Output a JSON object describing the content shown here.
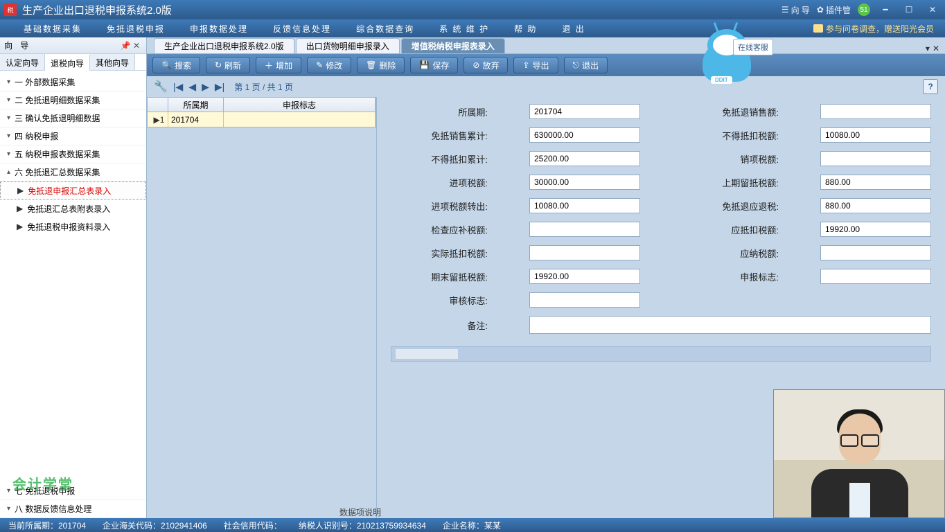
{
  "titlebar": {
    "app_title": "生产企业出口退税申报系统2.0版",
    "guide_link": "向 导",
    "plugin_link": "插件管",
    "badge": "51"
  },
  "menubar": {
    "items": [
      "基础数据采集",
      "免抵退税申报",
      "申报数据处理",
      "反馈信息处理",
      "综合数据查询",
      "系 统 维 护",
      "帮  助",
      "退  出"
    ],
    "survey": "参与问卷调查，赠送阳光会员"
  },
  "sidebar": {
    "title": "向  导",
    "tabs": [
      "认定向导",
      "退税向导",
      "其他向导"
    ],
    "active_tab": 1,
    "steps": [
      {
        "label": "一  外部数据采集"
      },
      {
        "label": "二  免抵退明细数据采集"
      },
      {
        "label": "三  确认免抵退明细数据"
      },
      {
        "label": "四  纳税申报"
      },
      {
        "label": "五  纳税申报表数据采集"
      },
      {
        "label": "六  免抵退汇总数据采集"
      }
    ],
    "children6": [
      {
        "label": "免抵退申报汇总表录入",
        "active": true
      },
      {
        "label": "免抵退汇总表附表录入"
      },
      {
        "label": "免抵退税申报资料录入"
      }
    ],
    "bottom": [
      {
        "label": "七  免抵退税申报"
      },
      {
        "label": "八  数据反馈信息处理"
      }
    ]
  },
  "tabs": {
    "items": [
      "生产企业出口退税申报系统2.0版",
      "出口货物明细申报录入",
      "增值税纳税申报表录入"
    ],
    "active": 2
  },
  "toolbar": {
    "search": "搜索",
    "refresh": "刷新",
    "add": "增加",
    "edit": "修改",
    "delete": "删除",
    "save": "保存",
    "discard": "放弃",
    "export": "导出",
    "exit": "退出"
  },
  "pager": {
    "text": "第 1 页 / 共 1 页"
  },
  "grid": {
    "headers": [
      "所属期",
      "申报标志"
    ],
    "rows": [
      {
        "rownum": "1",
        "period": "201704",
        "flag": ""
      }
    ]
  },
  "form": {
    "col1": [
      {
        "label": "所属期:",
        "value": "201704",
        "name": "period"
      },
      {
        "label": "免抵销售累计:",
        "value": "630000.00",
        "name": "mdxs-total"
      },
      {
        "label": "不得抵扣累计:",
        "value": "25200.00",
        "name": "bddk-total"
      },
      {
        "label": "进项税额:",
        "value": "30000.00",
        "name": "jxse"
      },
      {
        "label": "进项税额转出:",
        "value": "10080.00",
        "name": "jxse-out"
      },
      {
        "label": "检查应补税额:",
        "value": "",
        "name": "jcybse"
      },
      {
        "label": "实际抵扣税额:",
        "value": "",
        "name": "sjdkse"
      },
      {
        "label": "期末留抵税额:",
        "value": "19920.00",
        "name": "qmldse"
      },
      {
        "label": "审核标志:",
        "value": "",
        "name": "shbz"
      }
    ],
    "col2": [
      {
        "label": "免抵退销售额:",
        "value": "",
        "name": "mdtxse"
      },
      {
        "label": "不得抵扣税额:",
        "value": "10080.00",
        "name": "bddkse"
      },
      {
        "label": "销项税额:",
        "value": "",
        "name": "xxse"
      },
      {
        "label": "上期留抵税额:",
        "value": "880.00",
        "name": "sqldse"
      },
      {
        "label": "免抵退应退税:",
        "value": "880.00",
        "name": "mdtyts"
      },
      {
        "label": "应抵扣税额:",
        "value": "19920.00",
        "name": "ydkse"
      },
      {
        "label": "应纳税额:",
        "value": "",
        "name": "ynse"
      },
      {
        "label": "申报标志:",
        "value": "",
        "name": "sbbz"
      }
    ],
    "remark_label": "备注:",
    "remark_value": ""
  },
  "online_service": "在线客服",
  "mascot_belt": "DDIT",
  "data_desc": "数据项说明",
  "statusbar": {
    "period": "当前所属期：201704",
    "customs": "企业海关代码：2102941406",
    "credit": "社会信用代码：",
    "taxid": "纳税人识别号：210213759934634",
    "company": "企业名称：某某"
  },
  "watermark": "会计学堂"
}
